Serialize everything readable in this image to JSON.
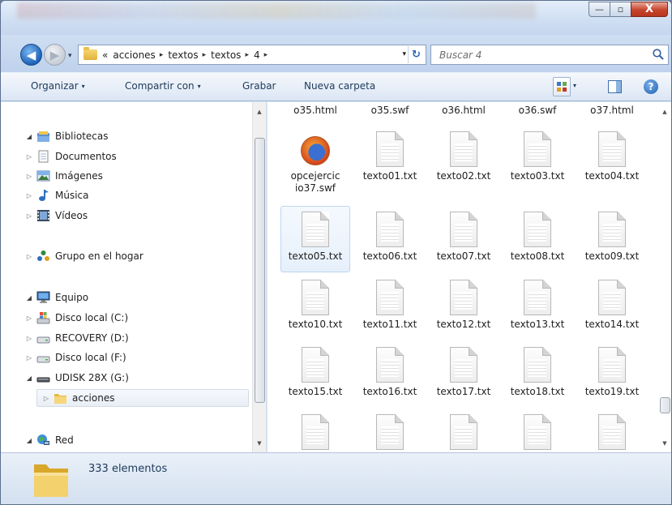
{
  "window": {
    "caption_buttons": {
      "minimize": "—",
      "maximize": "▫",
      "close": "X"
    }
  },
  "address": {
    "recent_glyph": "▾",
    "chevrons": "«",
    "crumbs": [
      "acciones",
      "textos",
      "textos",
      "4"
    ],
    "separator": "▸",
    "dropdown_glyph": "▾",
    "refresh_glyph": "↻"
  },
  "search": {
    "placeholder": "Buscar 4"
  },
  "toolbar": {
    "organize": "Organizar",
    "share": "Compartir con",
    "burn": "Grabar",
    "new_folder": "Nueva carpeta",
    "dropdown_glyph": "▾",
    "help": "?"
  },
  "nav": {
    "libraries": "Bibliotecas",
    "documents": "Documentos",
    "images": "Imágenes",
    "music": "Música",
    "videos": "Vídeos",
    "homegroup": "Grupo en el hogar",
    "computer": "Equipo",
    "drive_c": "Disco local (C:)",
    "drive_d": "RECOVERY (D:)",
    "drive_f": "Disco local (F:)",
    "drive_g": "UDISK 28X (G:)",
    "acciones": "acciones",
    "network": "Red",
    "tri_closed": "▷",
    "tri_open": "◢"
  },
  "files": {
    "top_row": [
      "o35.html",
      "o35.swf",
      "o36.html",
      "o36.swf",
      "o37.html"
    ],
    "grid": [
      [
        "opcejercicio37.swf",
        "texto01.txt",
        "texto02.txt",
        "texto03.txt",
        "texto04.txt"
      ],
      [
        "texto05.txt",
        "texto06.txt",
        "texto07.txt",
        "texto08.txt",
        "texto09.txt"
      ],
      [
        "texto10.txt",
        "texto11.txt",
        "texto12.txt",
        "texto13.txt",
        "texto14.txt"
      ],
      [
        "texto15.txt",
        "texto16.txt",
        "texto17.txt",
        "texto18.txt",
        "texto19.txt"
      ]
    ]
  },
  "status": {
    "count": "333 elementos"
  },
  "scroll": {
    "up": "▲",
    "down": "▼"
  }
}
